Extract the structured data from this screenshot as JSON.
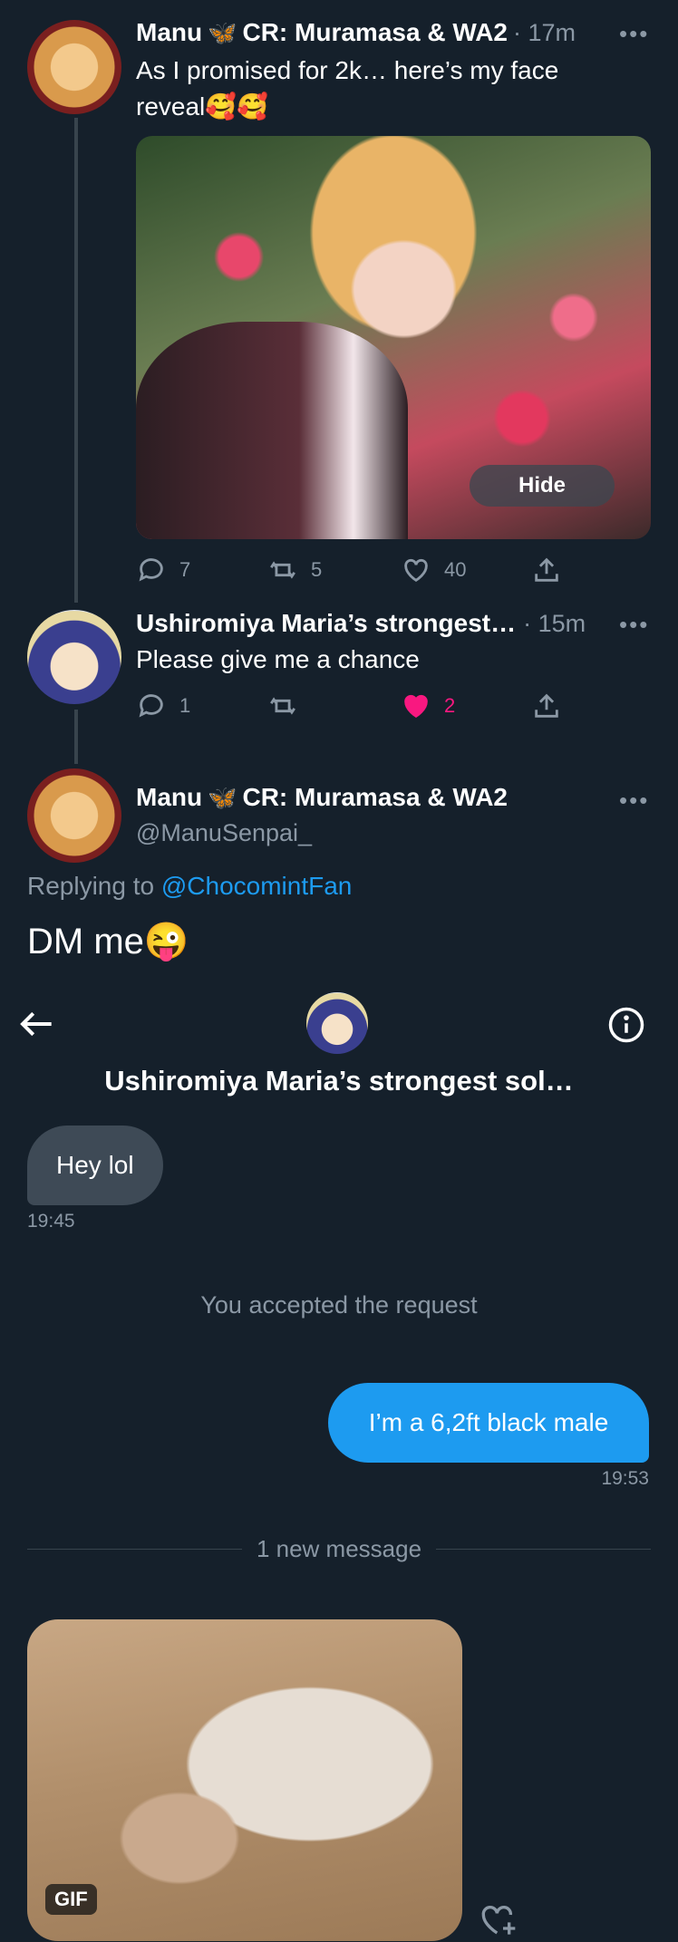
{
  "tweet1": {
    "author_name": "Manu",
    "author_name_suffix": "CR: Muramasa & WA2",
    "time": "· 17m",
    "more": "•••",
    "text": "As I promised for 2k… here’s my face reveal🥰🥰",
    "hide_label": "Hide",
    "replies": "7",
    "retweets": "5",
    "likes": "40"
  },
  "tweet2": {
    "author_name": "Ushiromiya Maria’s strongest…",
    "time": "· 15m",
    "more": "•••",
    "text": "Please give me a chance",
    "replies": "1",
    "likes": "2"
  },
  "tweet3": {
    "author_name": "Manu",
    "author_name_suffix": "CR: Muramasa & WA2",
    "handle": "@ManuSenpai_",
    "more": "•••",
    "replying_prefix": "Replying to",
    "replying_to": "@ChocomintFan",
    "text": "DM me😜"
  },
  "dm": {
    "title": "Ushiromiya Maria’s strongest sol…",
    "messages": {
      "received1": {
        "text": "Hey lol",
        "time": "19:45"
      },
      "system": "You accepted the request",
      "sent1": {
        "text": "I’m a 6,2ft black male",
        "time": "19:53"
      },
      "divider": "1 new message",
      "gif_badge": "GIF"
    }
  },
  "colors": {
    "background": "#15202b",
    "accent": "#1d9bf0",
    "like_pink": "#f91880",
    "muted": "#8b98a5",
    "received_bubble": "#3e4a56"
  }
}
